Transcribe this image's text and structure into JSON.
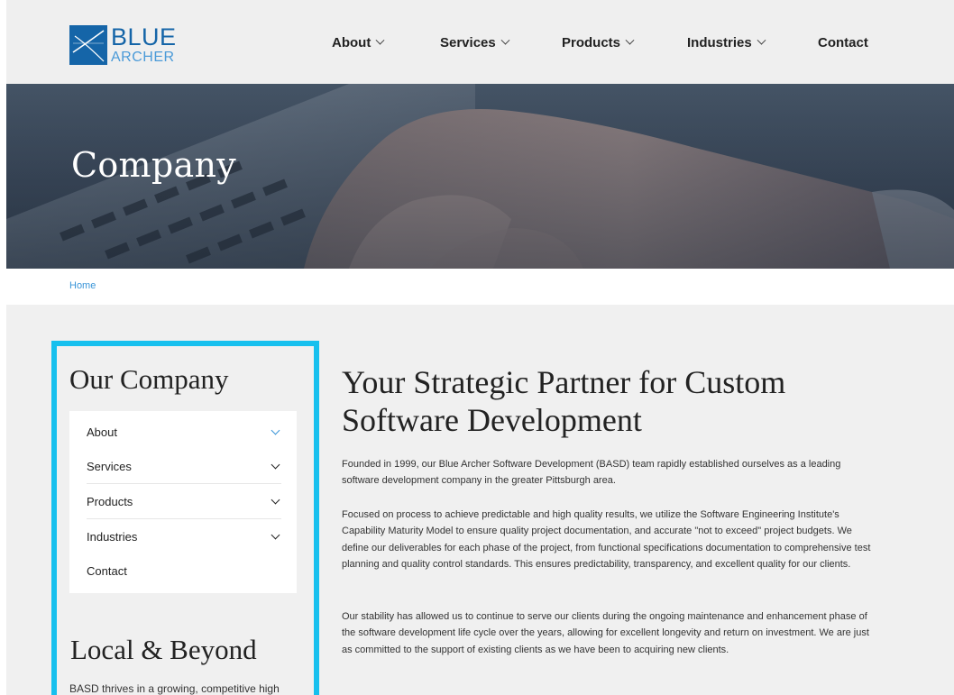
{
  "brand": {
    "logo_line1": "BLUE",
    "logo_line2": "ARCHER",
    "colors": {
      "brand_blue": "#1565a8",
      "accent_cyan": "#17c0ee",
      "link_blue": "#3a95d8"
    }
  },
  "nav": {
    "items": [
      {
        "label": "About",
        "icon": "chevron-down-icon"
      },
      {
        "label": "Services",
        "icon": "chevron-down-icon"
      },
      {
        "label": "Products",
        "icon": "chevron-down-icon"
      },
      {
        "label": "Industries",
        "icon": "chevron-down-icon"
      },
      {
        "label": "Contact"
      }
    ]
  },
  "hero": {
    "title": "Company"
  },
  "breadcrumb": {
    "home": "Home"
  },
  "sidebar": {
    "title": "Our Company",
    "items": [
      {
        "label": "About",
        "icon": "chevron-down-icon"
      },
      {
        "label": "Services",
        "icon": "chevron-down-icon"
      },
      {
        "label": "Products",
        "icon": "chevron-down-icon"
      },
      {
        "label": "Industries",
        "icon": "chevron-down-icon"
      },
      {
        "label": "Contact"
      }
    ],
    "local_title": "Local & Beyond",
    "local_text": "BASD thrives in a growing, competitive high"
  },
  "main": {
    "title": "Your Strategic Partner for Custom Software Development",
    "paragraphs": [
      "Founded in 1999,  our Blue Archer Software Development (BASD) team rapidly established ourselves as a leading software development company in the greater Pittsburgh area.",
      "Focused on process to achieve predictable and high quality results, we utilize the Software Engineering Institute's Capability Maturity Model to ensure quality project documentation, and accurate \"not to exceed\" project budgets. We define our deliverables for each phase of the project, from functional specifications documentation to comprehensive test planning and quality control standards. This ensures predictability, transparency, and excellent quality for our clients.",
      "Our stability has allowed us to continue to serve our clients during the ongoing maintenance and enhancement phase of the software development life cycle over the years, allowing for excellent longevity and return on investment. We are just as committed to the support of existing clients as we have been to acquiring new clients."
    ]
  }
}
